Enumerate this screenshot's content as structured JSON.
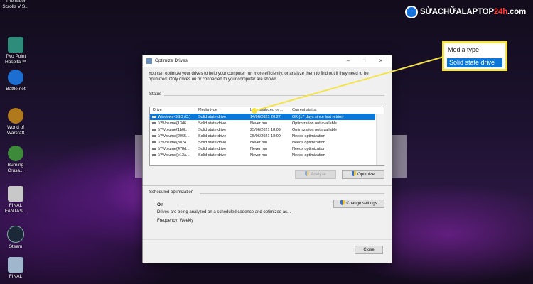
{
  "logo": {
    "text_a": "SỬACHỮALAPTOP",
    "text_b": "24h",
    "text_c": ".com"
  },
  "desktop_icons": [
    {
      "label": "The Elder Scrolls V S...",
      "color": "#5b6a80"
    },
    {
      "label": "Two Point Hospital™",
      "color": "#2d8c7a"
    },
    {
      "label": "Battle.net",
      "color": "#1c6fd1"
    },
    {
      "label": "World of Warcraft",
      "color": "#b07a1c"
    },
    {
      "label": "Burning Crusa...",
      "color": "#3c8a3a"
    },
    {
      "label": "FINAL FANTAS...",
      "color": "#c8c8c8"
    },
    {
      "label": "Steam",
      "color": "#1b2838"
    },
    {
      "label": "FINAL",
      "color": "#9fb6cc"
    }
  ],
  "window": {
    "title": "Optimize Drives",
    "intro": "You can optimize your drives to help your computer run more efficiently, or analyze them to find out if they need to be optimized. Only drives on or connected to your computer are shown.",
    "status_label": "Status",
    "columns": [
      "Drive",
      "Media type",
      "Last analyzed or ...",
      "Current status"
    ],
    "rows": [
      {
        "drive": "Windows-SSD (C:)",
        "media": "Solid state drive",
        "last": "14/06/2021 20:27",
        "status": "OK (17 days since last retrim)",
        "selected": true
      },
      {
        "drive": "\\\\?\\Volume{13d6...",
        "media": "Solid state drive",
        "last": "Never run",
        "status": "Optimization not available",
        "selected": false
      },
      {
        "drive": "\\\\?\\Volume{1b0f...",
        "media": "Solid state drive",
        "last": "25/06/2021 18:09",
        "status": "Optimization not available",
        "selected": false
      },
      {
        "drive": "\\\\?\\Volume{2065...",
        "media": "Solid state drive",
        "last": "25/06/2021 18:09",
        "status": "Needs optimization",
        "selected": false
      },
      {
        "drive": "\\\\?\\Volume{3024...",
        "media": "Solid state drive",
        "last": "Never run",
        "status": "Needs optimization",
        "selected": false
      },
      {
        "drive": "\\\\?\\Volume{478d...",
        "media": "Solid state drive",
        "last": "Never run",
        "status": "Needs optimization",
        "selected": false
      },
      {
        "drive": "\\\\?\\Volume{e13a...",
        "media": "Solid state drive",
        "last": "Never run",
        "status": "Needs optimization",
        "selected": false
      }
    ],
    "analyze_label": "Analyze",
    "optimize_label": "Optimize",
    "scheduled_label": "Scheduled optimization",
    "schedule_state": "On",
    "change_settings_label": "Change settings",
    "schedule_desc": "Drives are being analyzed on a scheduled cadence and optimized as...",
    "frequency": "Frequency: Weekly",
    "close_label": "Close"
  },
  "callout": {
    "header": "Media type",
    "selected": "Solid state drive",
    "border_color": "#f5e34a"
  }
}
